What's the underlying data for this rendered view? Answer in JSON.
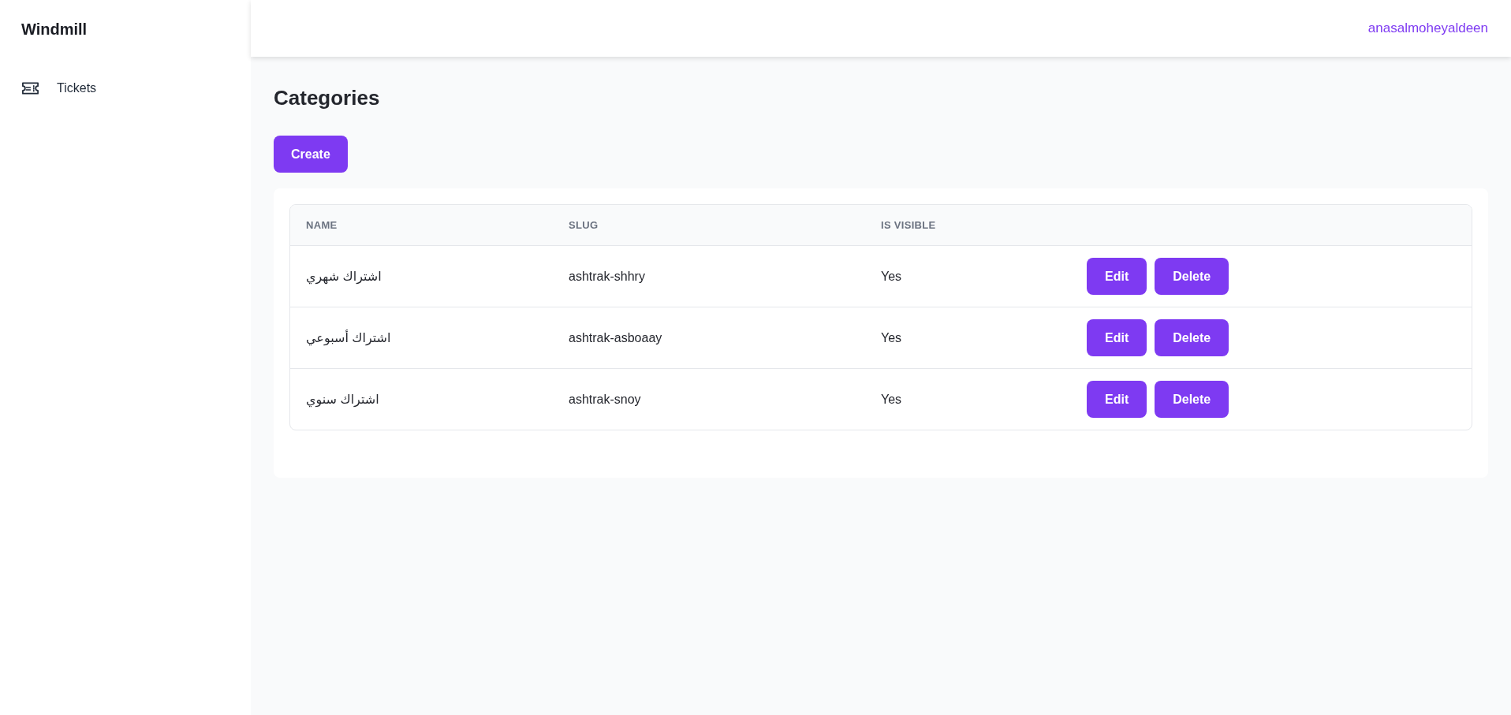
{
  "sidebar": {
    "brand": "Windmill",
    "items": [
      {
        "label": "Tickets",
        "selected": false
      }
    ]
  },
  "header": {
    "user": "anasalmoheyaldeen"
  },
  "page": {
    "title": "Categories",
    "create_button": "Create"
  },
  "table": {
    "columns": [
      "NAME",
      "SLUG",
      "IS VISIBLE"
    ],
    "rows": [
      {
        "name": "اشتراك شهري",
        "slug": "ashtrak-shhry",
        "is_visible": "Yes",
        "actions": [
          "Edit",
          "Delete"
        ]
      },
      {
        "name": "اشتراك أسبوعي",
        "slug": "ashtrak-asboaay",
        "is_visible": "Yes",
        "actions": [
          "Edit",
          "Delete"
        ]
      },
      {
        "name": "اشتراك سنوي",
        "slug": "ashtrak-snoy",
        "is_visible": "Yes",
        "actions": [
          "Edit",
          "Delete"
        ]
      }
    ]
  }
}
